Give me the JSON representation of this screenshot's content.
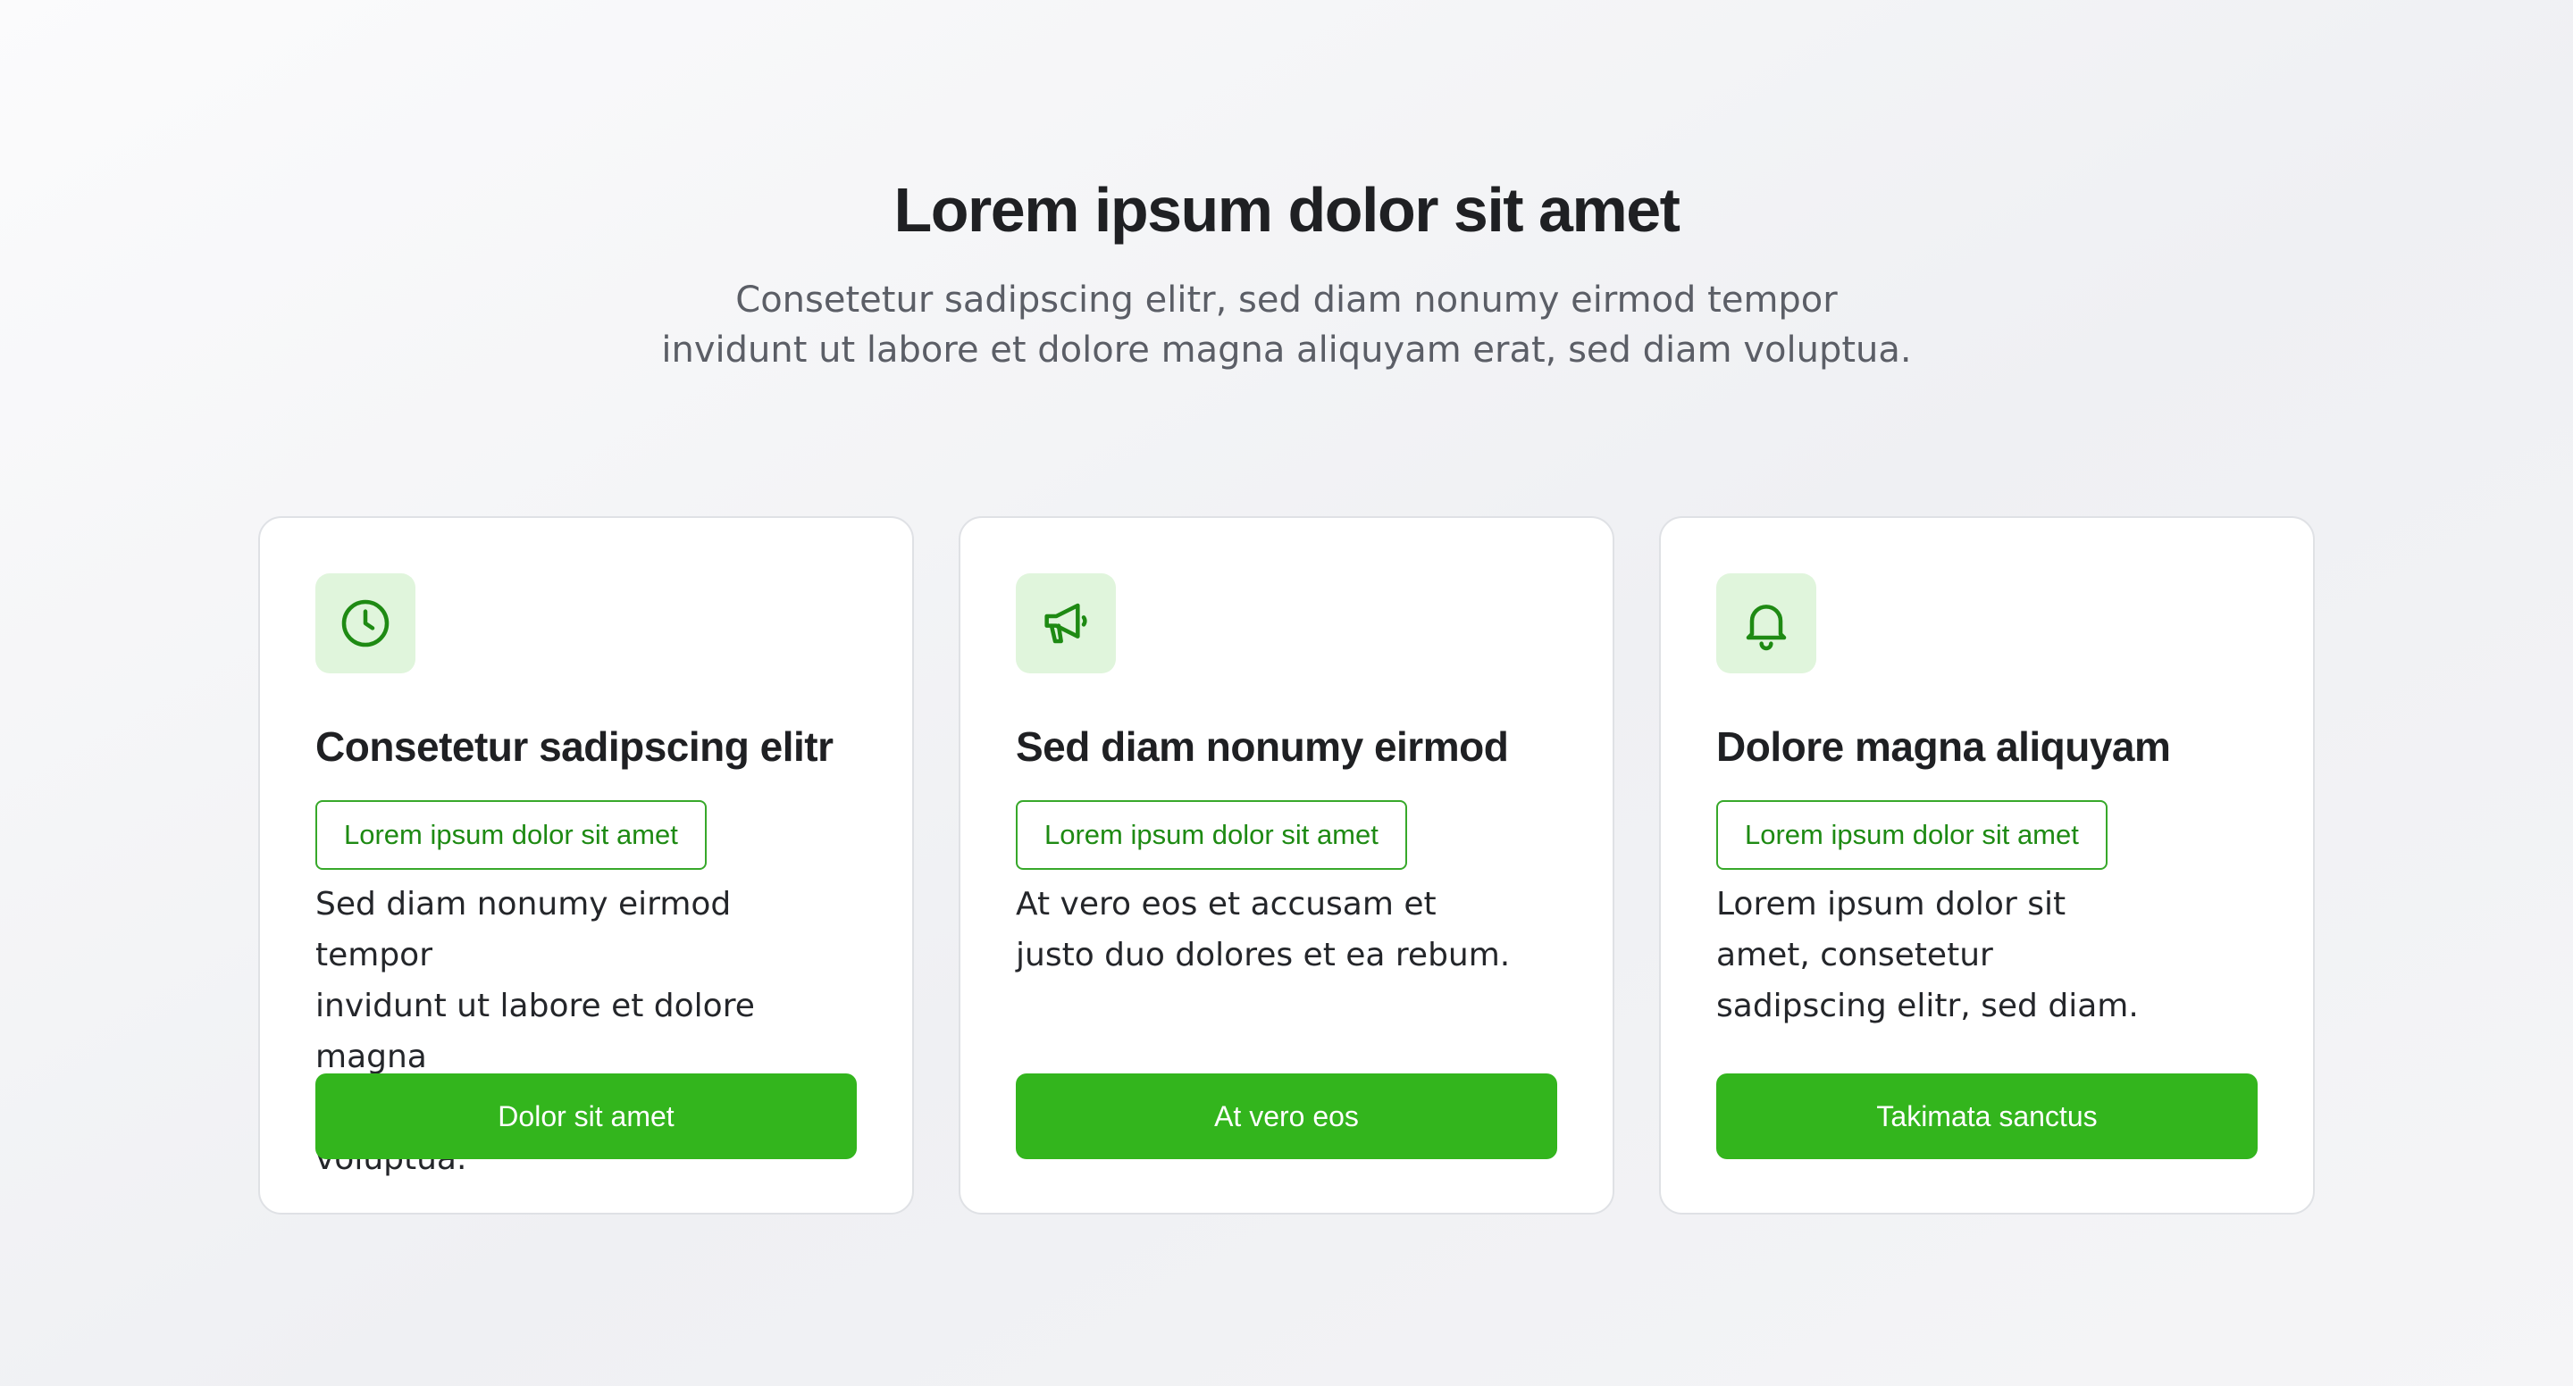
{
  "hero": {
    "title": "Lorem ipsum dolor sit amet",
    "subtitle_line1": "Consetetur sadipscing elitr, sed diam nonumy eirmod tempor",
    "subtitle_line2": "invidunt ut labore et dolore magna aliquyam erat, sed diam voluptua."
  },
  "colors": {
    "accent": "#33b51d",
    "accent_text": "#1e8a13",
    "icon_bg": "#e0f5dc",
    "heading": "#1f2023",
    "muted": "#5b5e66"
  },
  "cards": [
    {
      "icon": "clock-icon",
      "title": "Consetetur sadipscing elitr",
      "tag": "Lorem ipsum dolor sit amet",
      "desc_lines": [
        "Sed diam nonumy eirmod tempor",
        "invidunt ut labore et dolore magna",
        "aliquyam erat, sed diam voluptua."
      ],
      "button": "Dolor sit amet"
    },
    {
      "icon": "megaphone-icon",
      "title": "Sed diam nonumy eirmod",
      "tag": "Lorem ipsum dolor sit amet",
      "desc_lines": [
        "At vero eos et accusam et",
        "justo duo dolores et ea rebum."
      ],
      "button": "At vero eos"
    },
    {
      "icon": "bell-icon",
      "title": "Dolore magna aliquyam",
      "tag": "Lorem ipsum dolor sit amet",
      "desc_lines": [
        "Lorem ipsum dolor sit",
        "amet, consetetur",
        "sadipscing elitr, sed diam."
      ],
      "button": "Takimata sanctus"
    }
  ]
}
